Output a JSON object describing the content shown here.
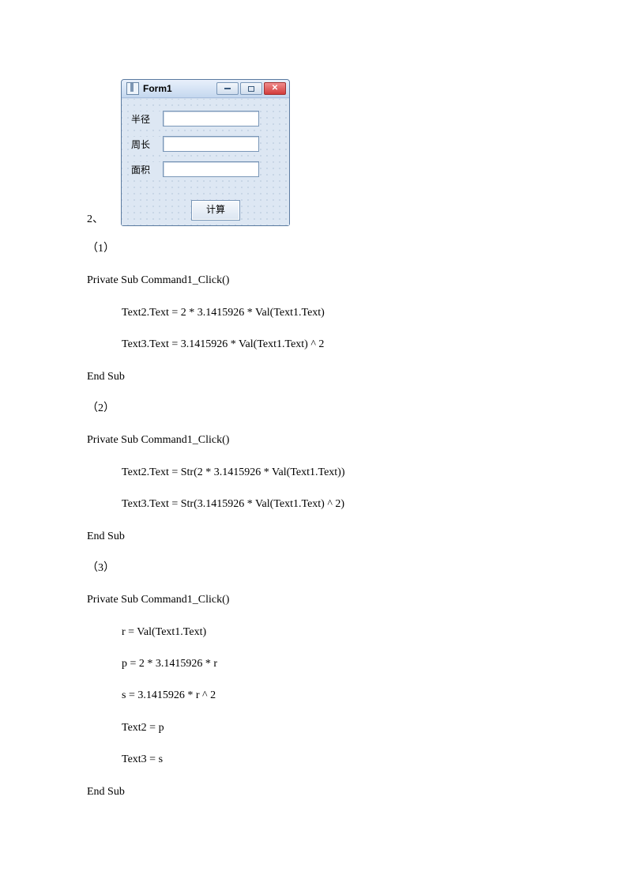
{
  "form": {
    "title": "Form1",
    "labels": {
      "radius": "半径",
      "perimeter": "周长",
      "area": "面积"
    },
    "button": "计算"
  },
  "item_prefix": "2、",
  "sections": {
    "s1": {
      "num": "（1）",
      "l1": "Private Sub Command1_Click()",
      "l2": "Text2.Text = 2 * 3.1415926 * Val(Text1.Text)",
      "l3": "Text3.Text = 3.1415926 * Val(Text1.Text) ^ 2",
      "l4": "End Sub"
    },
    "s2": {
      "num": "（2）",
      "l1": "Private Sub Command1_Click()",
      "l2": "Text2.Text = Str(2 * 3.1415926 * Val(Text1.Text))",
      "l3": "Text3.Text = Str(3.1415926 * Val(Text1.Text) ^ 2)",
      "l4": "End Sub"
    },
    "s3": {
      "num": "（3）",
      "l1": "Private Sub Command1_Click()",
      "l2": "r = Val(Text1.Text)",
      "l3": "p = 2 * 3.1415926 * r",
      "l4": "s = 3.1415926 * r ^ 2",
      "l5": "Text2 = p",
      "l6": "Text3 = s",
      "l7": "End Sub"
    }
  }
}
